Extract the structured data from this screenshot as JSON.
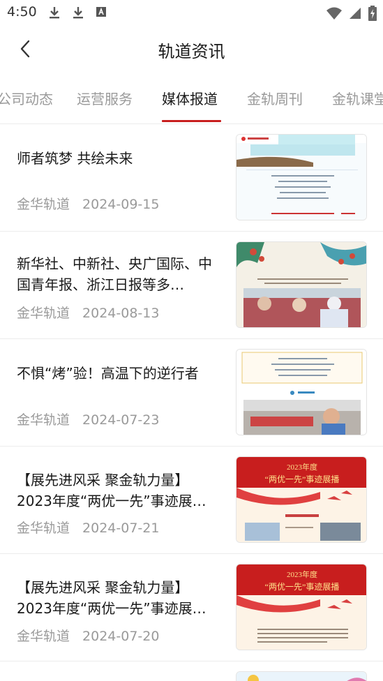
{
  "status_bar": {
    "time": "4:50",
    "left_icons": [
      "download-icon",
      "download-icon",
      "translate-icon"
    ],
    "right_icons": [
      "wifi-icon",
      "signal-icon",
      "battery-charging-icon"
    ]
  },
  "header": {
    "title": "轨道资讯",
    "back_icon": "chevron-left-icon"
  },
  "tabs": {
    "items": [
      {
        "label": "公司动态"
      },
      {
        "label": "运营服务"
      },
      {
        "label": "媒体报道"
      },
      {
        "label": "金轨周刊"
      },
      {
        "label": "金轨课堂"
      }
    ],
    "active_index": 2,
    "accent_color": "#c81f1f"
  },
  "news": [
    {
      "title": "师者筑梦 共绘未来",
      "source": "金华轨道",
      "date": "2024-09-15"
    },
    {
      "title": "新华社、中新社、央广国际、中国青年报、浙江日报等多…",
      "source": "金华轨道",
      "date": "2024-08-13"
    },
    {
      "title": "不惧“烤”验！高温下的逆行者",
      "source": "金华轨道",
      "date": "2024-07-23"
    },
    {
      "title": "【展先进风采 聚金轨力量】2023年度“两优一先”事迹展…",
      "source": "金华轨道",
      "date": "2024-07-21",
      "thumb_text": [
        "2023年度",
        "“两优一先”事迹展播"
      ]
    },
    {
      "title": "【展先进风采 聚金轨力量】2023年度“两优一先”事迹展…",
      "source": "金华轨道",
      "date": "2024-07-20",
      "thumb_text": [
        "2023年度",
        "“两优一先”事迹展播"
      ]
    }
  ]
}
